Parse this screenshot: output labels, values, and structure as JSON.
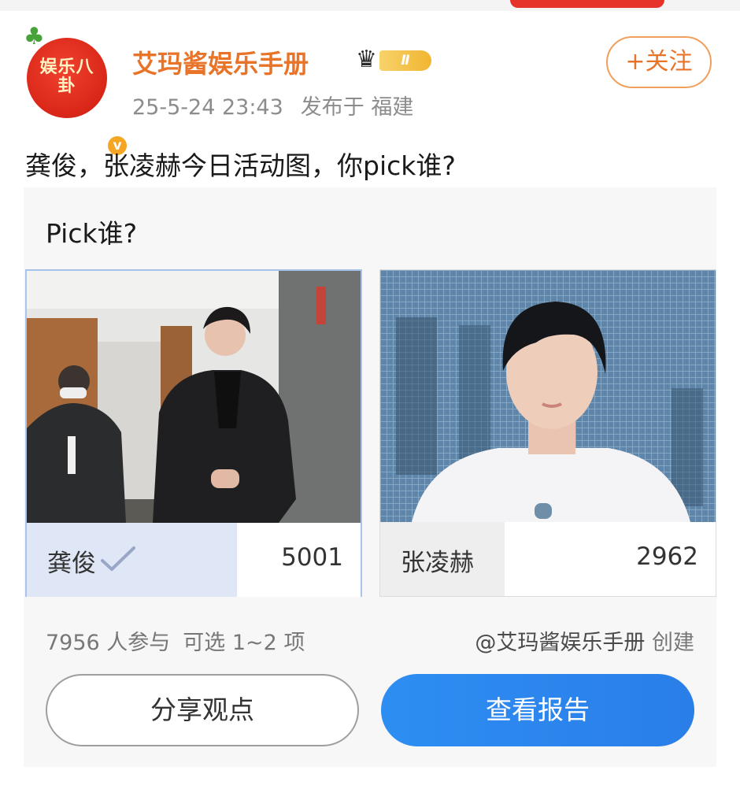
{
  "header": {
    "avatar_text": "娱乐八卦",
    "avatar_badge": "v",
    "username": "艾玛酱娱乐手册",
    "rank_label": "Ⅱ",
    "timestamp": "25-5-24 23:43",
    "location": "发布于 福建",
    "follow_label": "+关注"
  },
  "post": {
    "text": "龚俊，张凌赫今日活动图，你pick谁?"
  },
  "poll": {
    "title": "Pick谁?",
    "options": [
      {
        "name": "龚俊",
        "votes": "5001",
        "selected": true,
        "share": 0.63
      },
      {
        "name": "张凌赫",
        "votes": "2962",
        "selected": false,
        "share": 0.37
      }
    ],
    "participants": "7956 人参与",
    "selection_rule": "可选 1~2 项",
    "creator": "@艾玛酱娱乐手册",
    "creator_suffix": "创建",
    "share_label": "分享观点",
    "report_label": "查看报告"
  },
  "colors": {
    "accent_orange": "#e8742a",
    "button_blue": "#2d8ef2",
    "selected_fill": "#dfe7f6"
  },
  "icons": [
    "clover-icon",
    "verified-icon",
    "crown-icon",
    "check-icon"
  ]
}
